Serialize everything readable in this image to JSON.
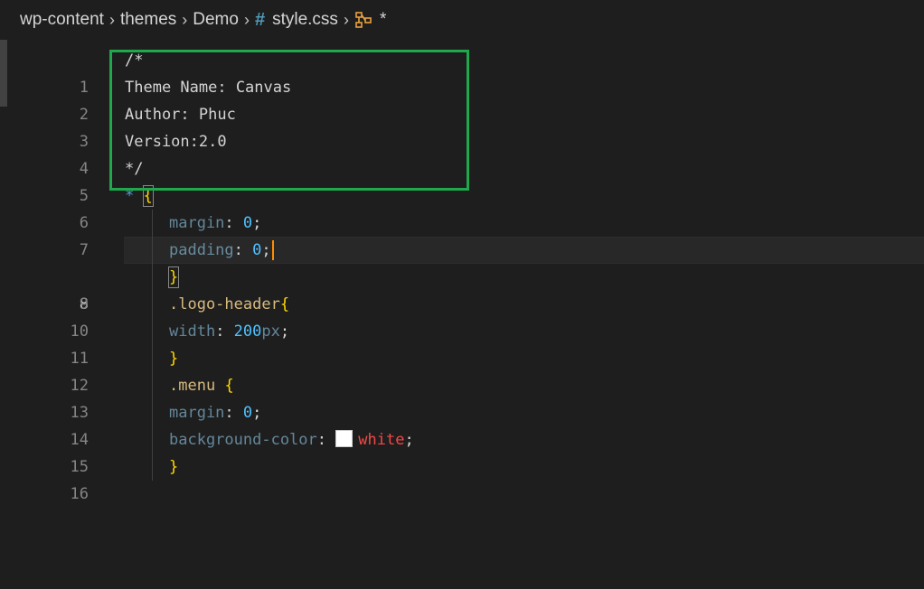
{
  "breadcrumb": {
    "segments": [
      "wp-content",
      "themes",
      "Demo",
      "style.css",
      "*"
    ],
    "separator": "›",
    "file_icon": "#"
  },
  "editor": {
    "lines": [
      {
        "n": "1",
        "text": "/*"
      },
      {
        "n": "2",
        "text": "Theme Name: Canvas"
      },
      {
        "n": "3",
        "text": "Author: Phuc"
      },
      {
        "n": "4",
        "text": "Version:2.0"
      },
      {
        "n": "5",
        "text": "*/"
      },
      {
        "n": "6",
        "text": "* {"
      },
      {
        "n": "7",
        "text": "margin: 0;"
      },
      {
        "n": "8",
        "text": "padding: 0;"
      },
      {
        "n": "9",
        "text": "}"
      },
      {
        "n": "10",
        "text": ".logo-header{"
      },
      {
        "n": "11",
        "text": "width: 200px;"
      },
      {
        "n": "12",
        "text": "}"
      },
      {
        "n": "13",
        "text": ".menu {"
      },
      {
        "n": "14",
        "text": "margin: 0;"
      },
      {
        "n": "15",
        "text": "background-color: white;"
      },
      {
        "n": "16",
        "text": "}"
      }
    ],
    "tokens": {
      "l7_prop": "margin",
      "l7_val": "0",
      "l8_prop": "padding",
      "l8_val": "0",
      "l10_sel": ".logo-header",
      "l11_prop": "width",
      "l11_num": "200",
      "l11_unit": "px",
      "l13_sel": ".menu",
      "l14_prop": "margin",
      "l14_val": "0",
      "l15_prop": "background-color",
      "l15_val": "white"
    },
    "current_line": "8"
  },
  "colors": {
    "highlight_box": "#1fa84c",
    "background": "#1e1e1e",
    "swatch": "#ffffff"
  }
}
